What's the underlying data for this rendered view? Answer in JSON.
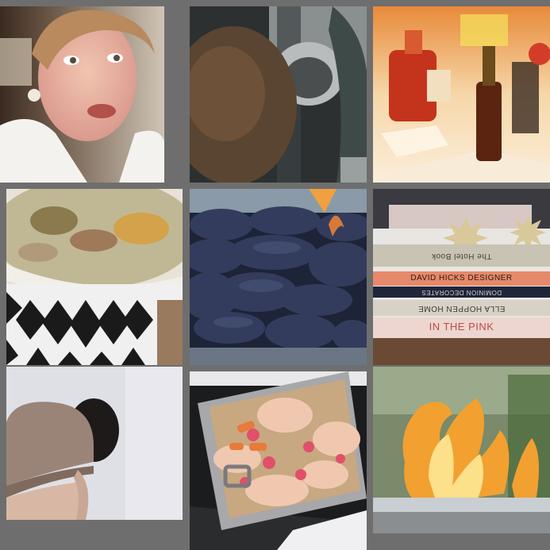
{
  "collage": {
    "tiles": [
      {
        "name": "woman-portrait"
      },
      {
        "name": "cast-iron-pans"
      },
      {
        "name": "sauce-bottles-table"
      },
      {
        "name": "chicken-casserole"
      },
      {
        "name": "fire-pit-stones"
      },
      {
        "name": "book-stack"
      },
      {
        "name": "cook-in-cap"
      },
      {
        "name": "roasting-pan-chicken"
      },
      {
        "name": "gas-flames"
      }
    ],
    "books": [
      {
        "title": "The Hotel Book",
        "color": "#c9c3b3"
      },
      {
        "title": "DAVID HICKS DESIGNER",
        "color": "#e6896a"
      },
      {
        "title": "DOMINION DECORATES",
        "color": "#20253a"
      },
      {
        "title": "ELLA HOPPEN HOME",
        "color": "#d8d2c6"
      },
      {
        "title": "IN THE PINK",
        "color": "#ecd6cf"
      }
    ]
  }
}
